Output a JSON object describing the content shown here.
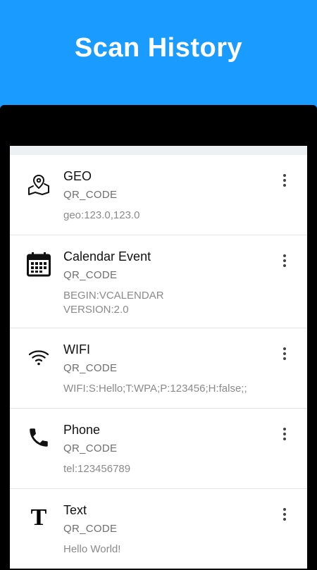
{
  "header": {
    "title": "Scan History"
  },
  "items": [
    {
      "icon": "map-pin-icon",
      "title": "GEO",
      "format": "QR_CODE",
      "content": "geo:123.0,123.0"
    },
    {
      "icon": "calendar-icon",
      "title": "Calendar Event",
      "format": "QR_CODE",
      "content": "BEGIN:VCALENDAR\nVERSION:2.0"
    },
    {
      "icon": "wifi-icon",
      "title": "WIFI",
      "format": "QR_CODE",
      "content": "WIFI:S:Hello;T:WPA;P:123456;H:false;;"
    },
    {
      "icon": "phone-icon",
      "title": "Phone",
      "format": "QR_CODE",
      "content": "tel:123456789"
    },
    {
      "icon": "text-icon",
      "title": "Text",
      "format": "QR_CODE",
      "content": "Hello World!"
    }
  ],
  "colors": {
    "accent": "#1a9bff",
    "device": "#000000",
    "list_bg": "#ffffff"
  }
}
